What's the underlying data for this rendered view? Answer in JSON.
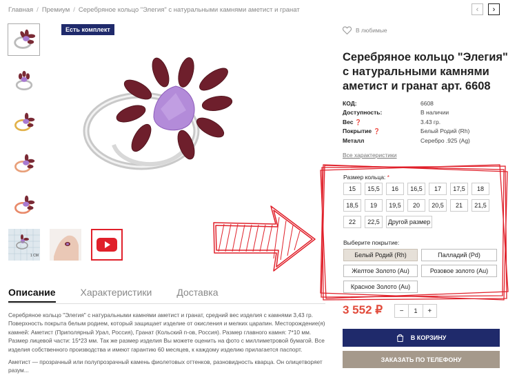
{
  "breadcrumb": {
    "home": "Главная",
    "category": "Премиум",
    "current": "Серебряное кольцо \"Элегия\" с натуральными камнями аметист и гранат"
  },
  "badge": "Есть комплект",
  "favorites": "В любимые",
  "product": {
    "title": "Серебряное кольцо \"Элегия\" с натуральными камнями аметист и гранат арт. 6608",
    "specs": [
      {
        "key": "КОД:",
        "value": "6608"
      },
      {
        "key": "Доступность:",
        "value": "В наличии"
      },
      {
        "key": "Вес",
        "value": "3.43 гр."
      },
      {
        "key": "Покрытие",
        "value": "Белый Родий (Rh)"
      },
      {
        "key": "Металл",
        "value": "Серебро .925 (Ag)"
      }
    ],
    "all_specs": "Все характеристики"
  },
  "sizes": {
    "label": "Размер кольца:",
    "required": "*",
    "row1": [
      "15",
      "15,5",
      "16",
      "16,5",
      "17",
      "17,5",
      "18"
    ],
    "row2": [
      "18,5",
      "19",
      "19,5",
      "20",
      "20,5",
      "21",
      "21,5"
    ],
    "row3": [
      "22",
      "22,5",
      "Другой размер"
    ]
  },
  "coating": {
    "label": "Выберите покрытие:",
    "options": [
      "Белый Родий (Rh)",
      "Палладий (Pd)",
      "Желтое Золото (Au)",
      "Розовое золото (Au)",
      "Красное Золото (Au)"
    ],
    "selected": "Белый Родий (Rh)"
  },
  "price": "3 552 ₽",
  "qty": {
    "minus": "−",
    "value": "1",
    "plus": "+"
  },
  "buttons": {
    "cart": "В КОРЗИНУ",
    "phone": "ЗАКАЗАТЬ ПО ТЕЛЕФОНУ"
  },
  "tabs": [
    "Описание",
    "Характеристики",
    "Доставка"
  ],
  "description": "Серебряное кольцо \"Элегия\" с натуральными камнями аметист и гранат, средний вес изделия с камнями 3,43 гр. Поверхность покрыта белым родием, который защищает изделие от окисления и мелких царапин. Месторождение(я) камней: Аметист (Приполярный Урал, Россия), Гранат (Кольский п-ов, Россия). Размер главного камня: 7*10 мм. Размер лицевой части: 15*23 мм. Так же размер изделия Вы можете оценить на фото с миллиметровой бумагой. Все изделия собственного производства и имеют гарантию 60 месяцев, к каждому изделию прилагается паспорт.",
  "description2": "Аметист — прозрачный или полупрозрачный камень фиолетовых оттенков, разновидность кварца. Он олицетворяет разум...",
  "scale_label": "1 СМ",
  "colors": {
    "navy": "#1f2a6b",
    "price": "#e14b3b",
    "tan": "#a5998b",
    "annotation": "#e0202a"
  }
}
